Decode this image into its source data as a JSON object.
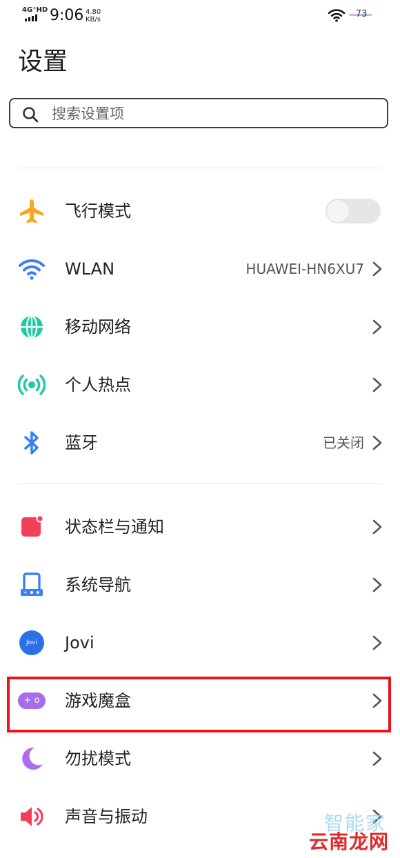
{
  "status_bar": {
    "network": "4G⁺HD",
    "time": "9:06",
    "speed_value": "4.80",
    "speed_unit": "KB/s",
    "battery": "73"
  },
  "page_title": "设置",
  "search": {
    "placeholder": "搜索设置项"
  },
  "section1": [
    {
      "label": "飞行模式",
      "icon": "airplane-icon",
      "toggle": false,
      "color": "#f5a623"
    },
    {
      "label": "WLAN",
      "icon": "wifi-icon",
      "value": "HUAWEI-HN6XU7",
      "color": "#3b82f0"
    },
    {
      "label": "移动网络",
      "icon": "globe-icon",
      "color": "#20c9a6"
    },
    {
      "label": "个人热点",
      "icon": "hotspot-icon",
      "color": "#20c9a6"
    },
    {
      "label": "蓝牙",
      "icon": "bluetooth-icon",
      "value": "已关闭",
      "color": "#3b82f0"
    }
  ],
  "section2": [
    {
      "label": "状态栏与通知",
      "icon": "notification-icon",
      "color": "#f2405a"
    },
    {
      "label": "系统导航",
      "icon": "navigation-icon",
      "color": "#3b82f0"
    },
    {
      "label": "Jovi",
      "icon": "jovi-icon",
      "icon_text": "Jovi",
      "color": "#2d6fe6"
    },
    {
      "label": "游戏魔盒",
      "icon": "gamepad-icon",
      "icon_text": "+ o",
      "color": "#a86ce8"
    },
    {
      "label": "勿扰模式",
      "icon": "moon-icon",
      "color": "#b06cf0"
    },
    {
      "label": "声音与振动",
      "icon": "speaker-icon",
      "color": "#f2405a"
    }
  ],
  "highlight_color": "#e8141a",
  "watermark": {
    "top": "智能家",
    "bottom": "云南龙网"
  }
}
